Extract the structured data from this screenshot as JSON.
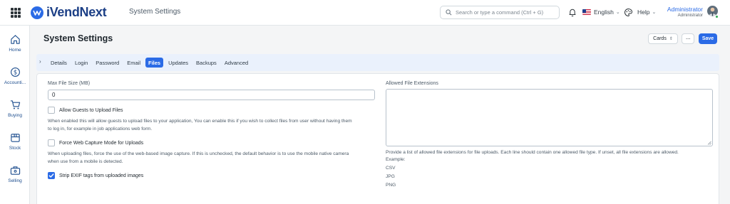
{
  "app": {
    "brand": "iVendNext",
    "nav_title": "System Settings",
    "search_placeholder": "Search or type a command (Ctrl + G)",
    "language": "English",
    "help": "Help",
    "user_name": "Administrator",
    "user_role": "Administrator",
    "accent_color": "#2b6be6"
  },
  "sidebar": {
    "items": [
      {
        "label": "Home",
        "icon": "home-icon"
      },
      {
        "label": "Accounti...",
        "icon": "dollar-icon"
      },
      {
        "label": "Buying",
        "icon": "cart-icon"
      },
      {
        "label": "Stock",
        "icon": "box-icon"
      },
      {
        "label": "Selling",
        "icon": "briefcase-icon"
      }
    ]
  },
  "page": {
    "title": "System Settings",
    "view_selector": "Cards",
    "more": "···",
    "save": "Save"
  },
  "tabs": [
    {
      "label": "Details",
      "active": false
    },
    {
      "label": "Login",
      "active": false
    },
    {
      "label": "Password",
      "active": false
    },
    {
      "label": "Email",
      "active": false
    },
    {
      "label": "Files",
      "active": true
    },
    {
      "label": "Updates",
      "active": false
    },
    {
      "label": "Backups",
      "active": false
    },
    {
      "label": "Advanced",
      "active": false
    }
  ],
  "form": {
    "max_file_size_label": "Max File Size (MB)",
    "max_file_size_value": "0",
    "allow_guests_label": "Allow Guests to Upload Files",
    "allow_guests_checked": false,
    "allow_guests_desc_1": "When enabled this will allow guests to upload files to your application, You can enable this if you wish to collect files from user without having them",
    "allow_guests_desc_2": "to log in, for example in job applications web form.",
    "force_web_capture_label": "Force Web Capture Mode for Uploads",
    "force_web_capture_checked": false,
    "force_web_capture_desc_1": "When uploading files, force the use of the web-based image capture. If this is unchecked, the default behavior is to use the mobile native camera",
    "force_web_capture_desc_2": "when use from a mobile is detected.",
    "strip_exif_label": "Strip EXIF tags from uploaded images",
    "strip_exif_checked": true,
    "allowed_ext_label": "Allowed File Extensions",
    "allowed_ext_value": "",
    "allowed_ext_desc": "Provide a list of allowed file extensions for file uploads. Each line should contain one allowed file type. If unset, all file extensions are allowed.",
    "example_label": "Example:",
    "example_lines": [
      "CSV",
      "JPG",
      "PNG"
    ]
  }
}
